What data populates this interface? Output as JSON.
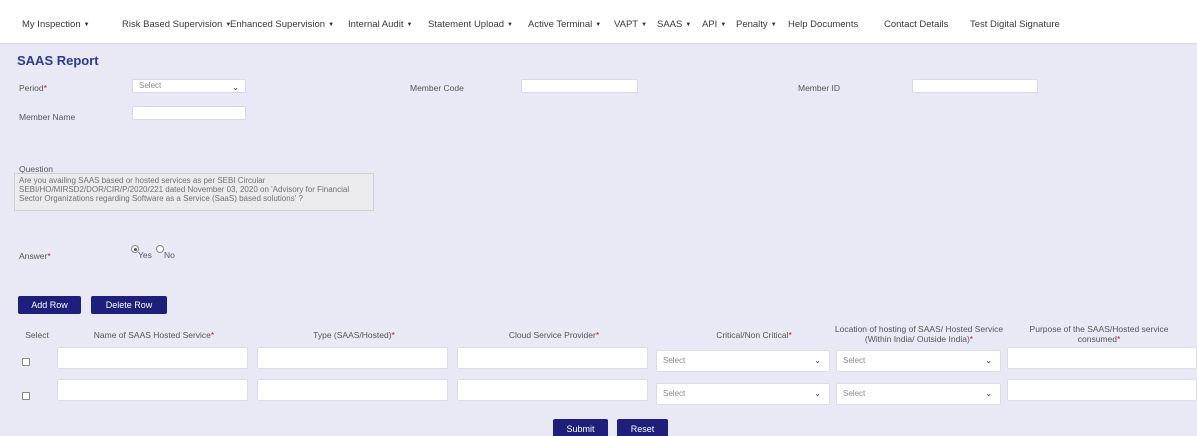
{
  "nav": {
    "items": [
      {
        "label": "My Inspection",
        "caret": true
      },
      {
        "label": "Risk Based Supervision",
        "caret": true
      },
      {
        "label": "Enhanced Supervision",
        "caret": true
      },
      {
        "label": "Internal Audit",
        "caret": true
      },
      {
        "label": "Statement Upload",
        "caret": true
      },
      {
        "label": "Active Terminal",
        "caret": true
      },
      {
        "label": "VAPT",
        "caret": true
      },
      {
        "label": "SAAS",
        "caret": true
      },
      {
        "label": "API",
        "caret": true
      },
      {
        "label": "Penalty",
        "caret": true
      },
      {
        "label": "Help Documents",
        "caret": false
      },
      {
        "label": "Contact Details",
        "caret": false
      },
      {
        "label": "Test Digital Signature",
        "caret": false
      }
    ]
  },
  "page": {
    "title": "SAAS Report"
  },
  "form": {
    "period_label": "Period",
    "period_value": "Select",
    "member_code_label": "Member Code",
    "member_code_value": "",
    "member_id_label": "Member ID",
    "member_id_value": "",
    "member_name_label": "Member Name",
    "member_name_value": "",
    "question_label": "Question",
    "question_text": "Are you availing SAAS based or hosted services as per SEBI Circular SEBI/HO/MIRSD2/DOR/CIR/P/2020/221 dated November 03, 2020 on 'Advisory for Financial Sector Organizations regarding Software as a Service (SaaS) based solutions' ?",
    "answer_label": "Answer",
    "answer_yes": "Yes",
    "answer_no": "No",
    "answer_selected": "Yes",
    "required_mark": "*"
  },
  "actions": {
    "add_row": "Add Row",
    "delete_row": "Delete Row",
    "submit": "Submit",
    "reset": "Reset"
  },
  "table": {
    "headers": {
      "select": "Select",
      "name": "Name of SAAS Hosted Service",
      "type": "Type (SAAS/Hosted)",
      "provider": "Cloud Service Provider",
      "critical": "Critical/Non Critical",
      "location": "Location of hosting of SAAS/ Hosted Service (Within India/ Outside India)",
      "purpose": "Purpose of the SAAS/Hosted service consumed"
    },
    "rows": [
      {
        "checked": false,
        "name": "",
        "type": "",
        "provider": "",
        "critical": "Select",
        "location": "Select",
        "purpose": ""
      },
      {
        "checked": false,
        "name": "",
        "type": "",
        "provider": "",
        "critical": "Select",
        "location": "Select",
        "purpose": ""
      }
    ]
  }
}
